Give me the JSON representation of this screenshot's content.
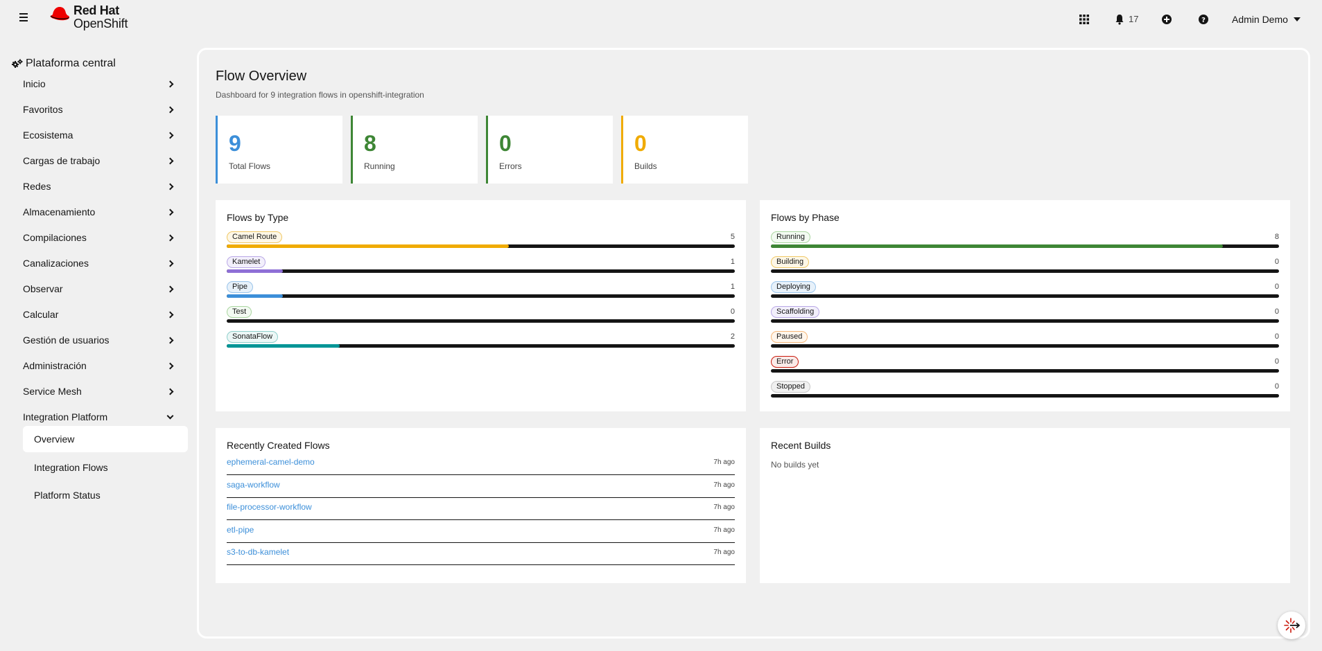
{
  "masthead": {
    "brand_line1": "Red Hat",
    "brand_line2": "OpenShift",
    "notification_count": "17",
    "user_name": "Admin Demo"
  },
  "sidebar": {
    "perspective": "Plataforma central",
    "items": [
      {
        "label": "Inicio"
      },
      {
        "label": "Favoritos"
      },
      {
        "label": "Ecosistema"
      },
      {
        "label": "Cargas de trabajo"
      },
      {
        "label": "Redes"
      },
      {
        "label": "Almacenamiento"
      },
      {
        "label": "Compilaciones"
      },
      {
        "label": "Canalizaciones"
      },
      {
        "label": "Observar"
      },
      {
        "label": "Calcular"
      },
      {
        "label": "Gestión de usuarios"
      },
      {
        "label": "Administración"
      },
      {
        "label": "Service Mesh"
      },
      {
        "label": "Integration Platform"
      }
    ],
    "sub_items": [
      {
        "label": "Overview"
      },
      {
        "label": "Integration Flows"
      },
      {
        "label": "Platform Status"
      }
    ]
  },
  "page": {
    "title": "Flow Overview",
    "subtitle": "Dashboard for 9 integration flows in openshift-integration"
  },
  "stats": [
    {
      "value": "9",
      "label": "Total Flows",
      "color": "#3c8fd9"
    },
    {
      "value": "8",
      "label": "Running",
      "color": "#3e8635"
    },
    {
      "value": "0",
      "label": "Errors",
      "color": "#3e8635"
    },
    {
      "value": "0",
      "label": "Builds",
      "color": "#f0ab00"
    }
  ],
  "flows_by_type": {
    "title": "Flows by Type",
    "total": 9,
    "rows": [
      {
        "label": "Camel Route",
        "count": "5",
        "value": 5,
        "color": "#f0ab00",
        "pill_bg": "#fdf7e7",
        "pill_border": "#f0c865"
      },
      {
        "label": "Kamelet",
        "count": "1",
        "value": 1,
        "color": "#8e6fd6",
        "pill_bg": "#f2effb",
        "pill_border": "#b9a8e6"
      },
      {
        "label": "Pipe",
        "count": "1",
        "value": 1,
        "color": "#3c8fd9",
        "pill_bg": "#e7f1fa",
        "pill_border": "#9ac4ea"
      },
      {
        "label": "Test",
        "count": "0",
        "value": 0,
        "color": "#3e8635",
        "pill_bg": "#f3faf2",
        "pill_border": "#a9d69f"
      },
      {
        "label": "SonataFlow",
        "count": "2",
        "value": 2,
        "color": "#009596",
        "pill_bg": "#ecf7f6",
        "pill_border": "#8fcfcb"
      }
    ]
  },
  "flows_by_phase": {
    "title": "Flows by Phase",
    "total": 9,
    "rows": [
      {
        "label": "Running",
        "count": "8",
        "value": 8,
        "color": "#3e8635",
        "pill_bg": "#f3faf2",
        "pill_border": "#a9d69f"
      },
      {
        "label": "Building",
        "count": "0",
        "value": 0,
        "color": "#f0ab00",
        "pill_bg": "#fdf7e7",
        "pill_border": "#f0c865"
      },
      {
        "label": "Deploying",
        "count": "0",
        "value": 0,
        "color": "#3c8fd9",
        "pill_bg": "#e7f1fa",
        "pill_border": "#9ac4ea"
      },
      {
        "label": "Scaffolding",
        "count": "0",
        "value": 0,
        "color": "#8e6fd6",
        "pill_bg": "#f2effb",
        "pill_border": "#b9a8e6"
      },
      {
        "label": "Paused",
        "count": "0",
        "value": 0,
        "color": "#ec7a08",
        "pill_bg": "#fff6ec",
        "pill_border": "#f4b678"
      },
      {
        "label": "Error",
        "count": "0",
        "value": 0,
        "color": "#c9190b",
        "pill_bg": "#faeae8",
        "pill_border": "#c9190b"
      },
      {
        "label": "Stopped",
        "count": "0",
        "value": 0,
        "color": "#6a6e73",
        "pill_bg": "#f0f0f0",
        "pill_border": "#c7c7c7"
      }
    ]
  },
  "recent_flows": {
    "title": "Recently Created Flows",
    "rows": [
      {
        "name": "ephemeral-camel-demo",
        "ago": "7h ago"
      },
      {
        "name": "saga-workflow",
        "ago": "7h ago"
      },
      {
        "name": "file-processor-workflow",
        "ago": "7h ago"
      },
      {
        "name": "etl-pipe",
        "ago": "7h ago"
      },
      {
        "name": "s3-to-db-kamelet",
        "ago": "7h ago"
      }
    ]
  },
  "recent_builds": {
    "title": "Recent Builds",
    "empty_text": "No builds yet"
  }
}
